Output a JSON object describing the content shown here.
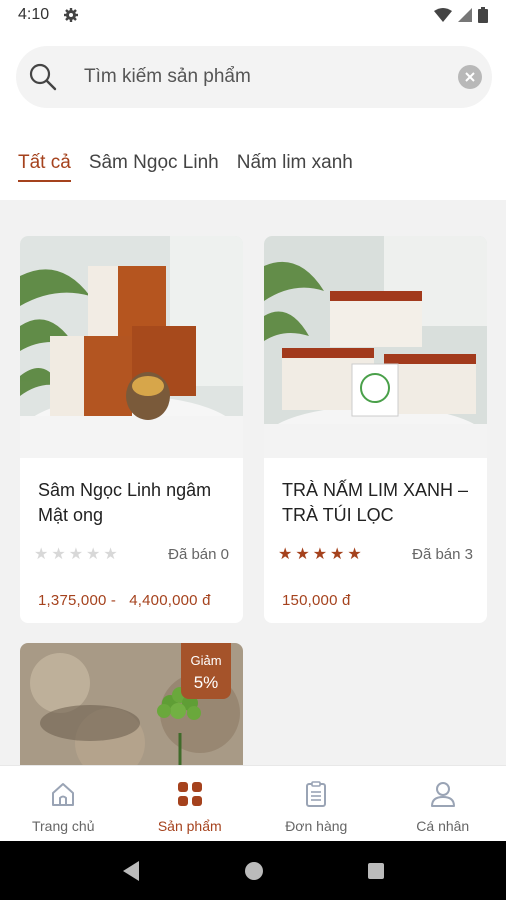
{
  "status_bar": {
    "time": "4:10",
    "icons": [
      "gear-icon",
      "wifi-icon",
      "signal-icon",
      "battery-icon"
    ]
  },
  "search": {
    "placeholder": "Tìm kiếm sản phẩm",
    "icon": "search-icon",
    "clear_icon": "clear-icon"
  },
  "tabs": [
    {
      "label": "Tất cả",
      "active": true
    },
    {
      "label": "Sâm Ngọc Linh",
      "active": false
    },
    {
      "label": "Nấm lim xanh",
      "active": false
    }
  ],
  "products": [
    {
      "title": "Sâm Ngọc Linh ngâm Mật ong",
      "rating": 0,
      "sold": "Đã bán 0",
      "price": "1,375,000 -   4,400,000 đ"
    },
    {
      "title": "TRÀ NẤM LIM XANH – TRÀ TÚI LỌC",
      "rating": 5,
      "sold": "Đã bán 3",
      "price": "150,000 đ"
    },
    {
      "title": "",
      "discount_label": "Giảm",
      "discount_value": "5%"
    }
  ],
  "bottom_nav": [
    {
      "label": "Trang chủ",
      "icon": "home-icon",
      "active": false
    },
    {
      "label": "Sản phẩm",
      "icon": "grid-icon",
      "active": true
    },
    {
      "label": "Đơn hàng",
      "icon": "clipboard-icon",
      "active": false
    },
    {
      "label": "Cá nhân",
      "icon": "person-icon",
      "active": false
    }
  ],
  "system_nav": [
    "back-icon",
    "home-circle-icon",
    "recents-icon"
  ],
  "colors": {
    "accent": "#a5421d",
    "background": "#f2f2f2"
  }
}
